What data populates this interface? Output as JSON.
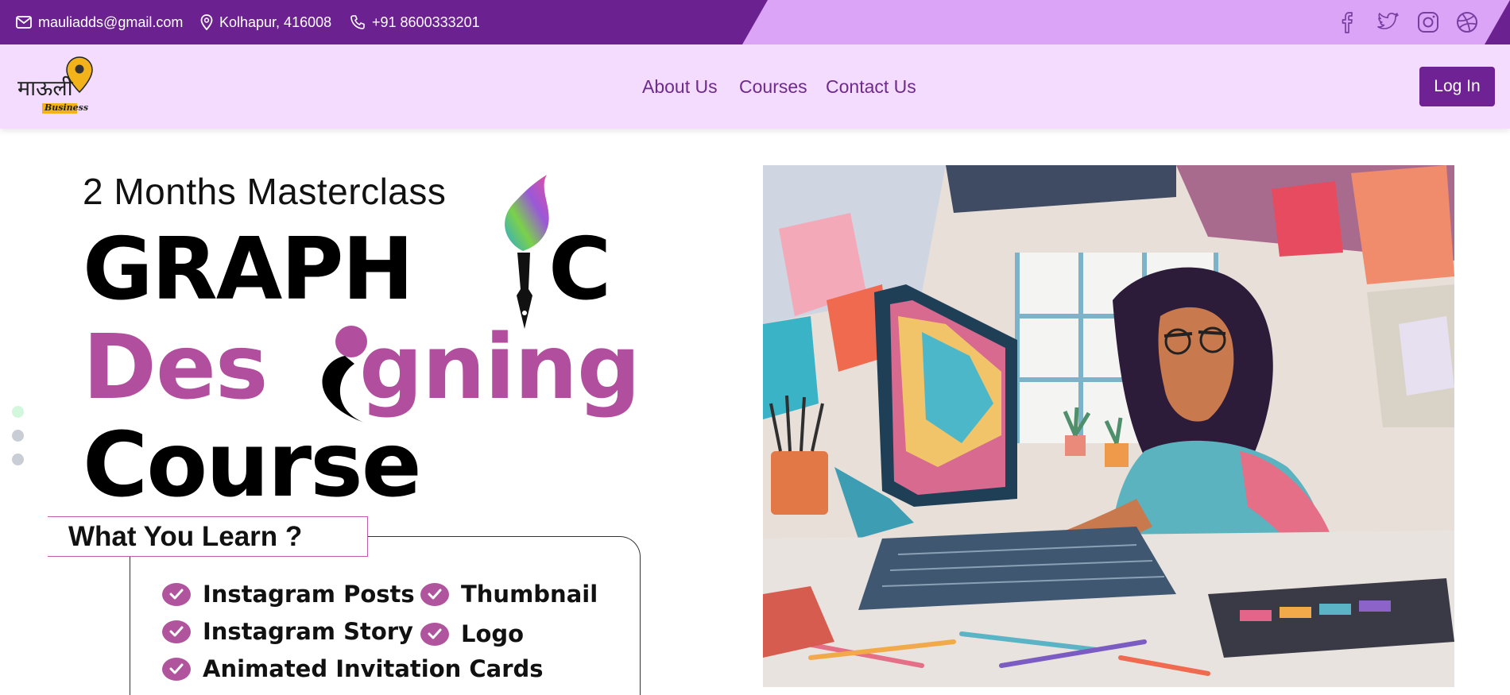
{
  "topbar": {
    "email": "mauliadds@gmail.com",
    "location": "Kolhapur, 416008",
    "phone": "+91 8600333201",
    "social": [
      "facebook-icon",
      "twitter-icon",
      "instagram-icon",
      "dribbble-icon"
    ]
  },
  "logo": {
    "text": "माऊली",
    "sub": "Business"
  },
  "nav": {
    "links": [
      "About Us",
      "Courses",
      "Contact Us"
    ],
    "login_label": "Log In"
  },
  "hero": {
    "line1": "2 Months Masterclass",
    "word1": "GRAPH",
    "word1_end": "C",
    "word2_a": "Des",
    "word2_b": "gning",
    "word3": "Course",
    "learn_title": "What You Learn ?",
    "items": [
      "Instagram Posts",
      "Thumbnail",
      "Instagram Story",
      "Logo",
      "Animated Invitation Cards"
    ]
  },
  "colors": {
    "topbar_dark": "#6b2190",
    "topbar_light": "#dba4f7",
    "navbar": "#f3dcfd",
    "accent": "#6e2293",
    "pink": "#b0549e"
  }
}
